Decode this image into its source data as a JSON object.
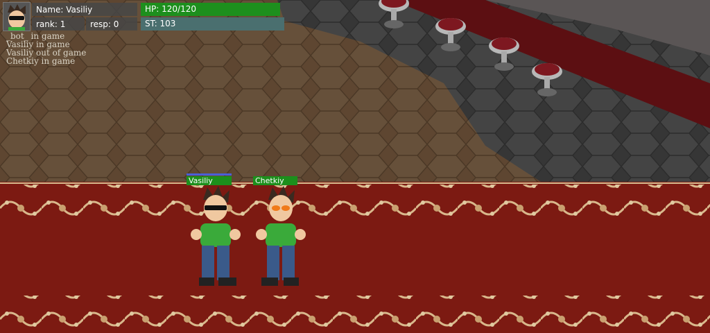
{
  "hud": {
    "name": "Name: Vasiliy",
    "rank": "rank: 1",
    "resp": "resp: 0",
    "hp": "HP: 120/120",
    "st": "ST: 103",
    "avatar_icon": "player-avatar-icon"
  },
  "event_log": [
    "_bot_ in game",
    "Vasiliy in game",
    "Vasiliy out of game",
    "Chetkiy in game"
  ],
  "players": [
    {
      "name": "Vasiliy",
      "glasses": "black"
    },
    {
      "name": "Chetkiy",
      "glasses": "orange"
    }
  ],
  "colors": {
    "hp": "#1d8f1d",
    "st": "#4a6f6f",
    "carpet": "#7c1a12",
    "floor_brown": "#5e4631",
    "floor_gray": "#404040"
  }
}
